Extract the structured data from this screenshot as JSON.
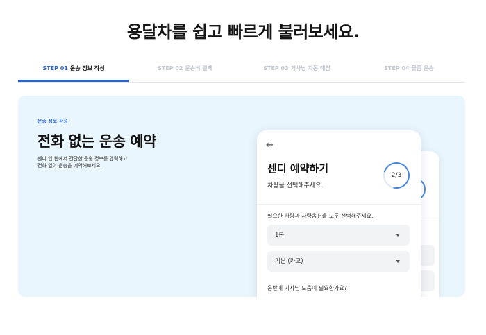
{
  "headline": "용달차를 쉽고 빠르게 불러보세요.",
  "steps": [
    {
      "num": "STEP 01",
      "label": "운송 정보 작성",
      "active": true
    },
    {
      "num": "STEP 02",
      "label": "운송비 결제",
      "active": false
    },
    {
      "num": "STEP 03",
      "label": "기사님 자동 매칭",
      "active": false
    },
    {
      "num": "STEP 04",
      "label": "물품 운송",
      "active": false
    }
  ],
  "hero": {
    "eyebrow": "운송 정보 작성",
    "title": "전화 없는 운송 예약",
    "desc_line1": "센디 앱·웹에서 간단한 운송 정보를 입력하고",
    "desc_line2": "전화 없이 운송을 예약해보세요."
  },
  "card": {
    "back_icon": "arrow-left-icon",
    "title": "센디 예약하기",
    "subtitle": "차량을 선택해주세요.",
    "progress_text": "2/3",
    "question1": "필요한 차량과 차량옵션을 모두 선택해주세요.",
    "vehicle_select": "1톤",
    "option_select": "기본 (카고)",
    "question2": "운반에 기사님 도움이 필요한가요?"
  },
  "colors": {
    "accent": "#2c63c9",
    "hero_bg": "#eaf6fd",
    "progress_ring": "#4a88dc"
  }
}
